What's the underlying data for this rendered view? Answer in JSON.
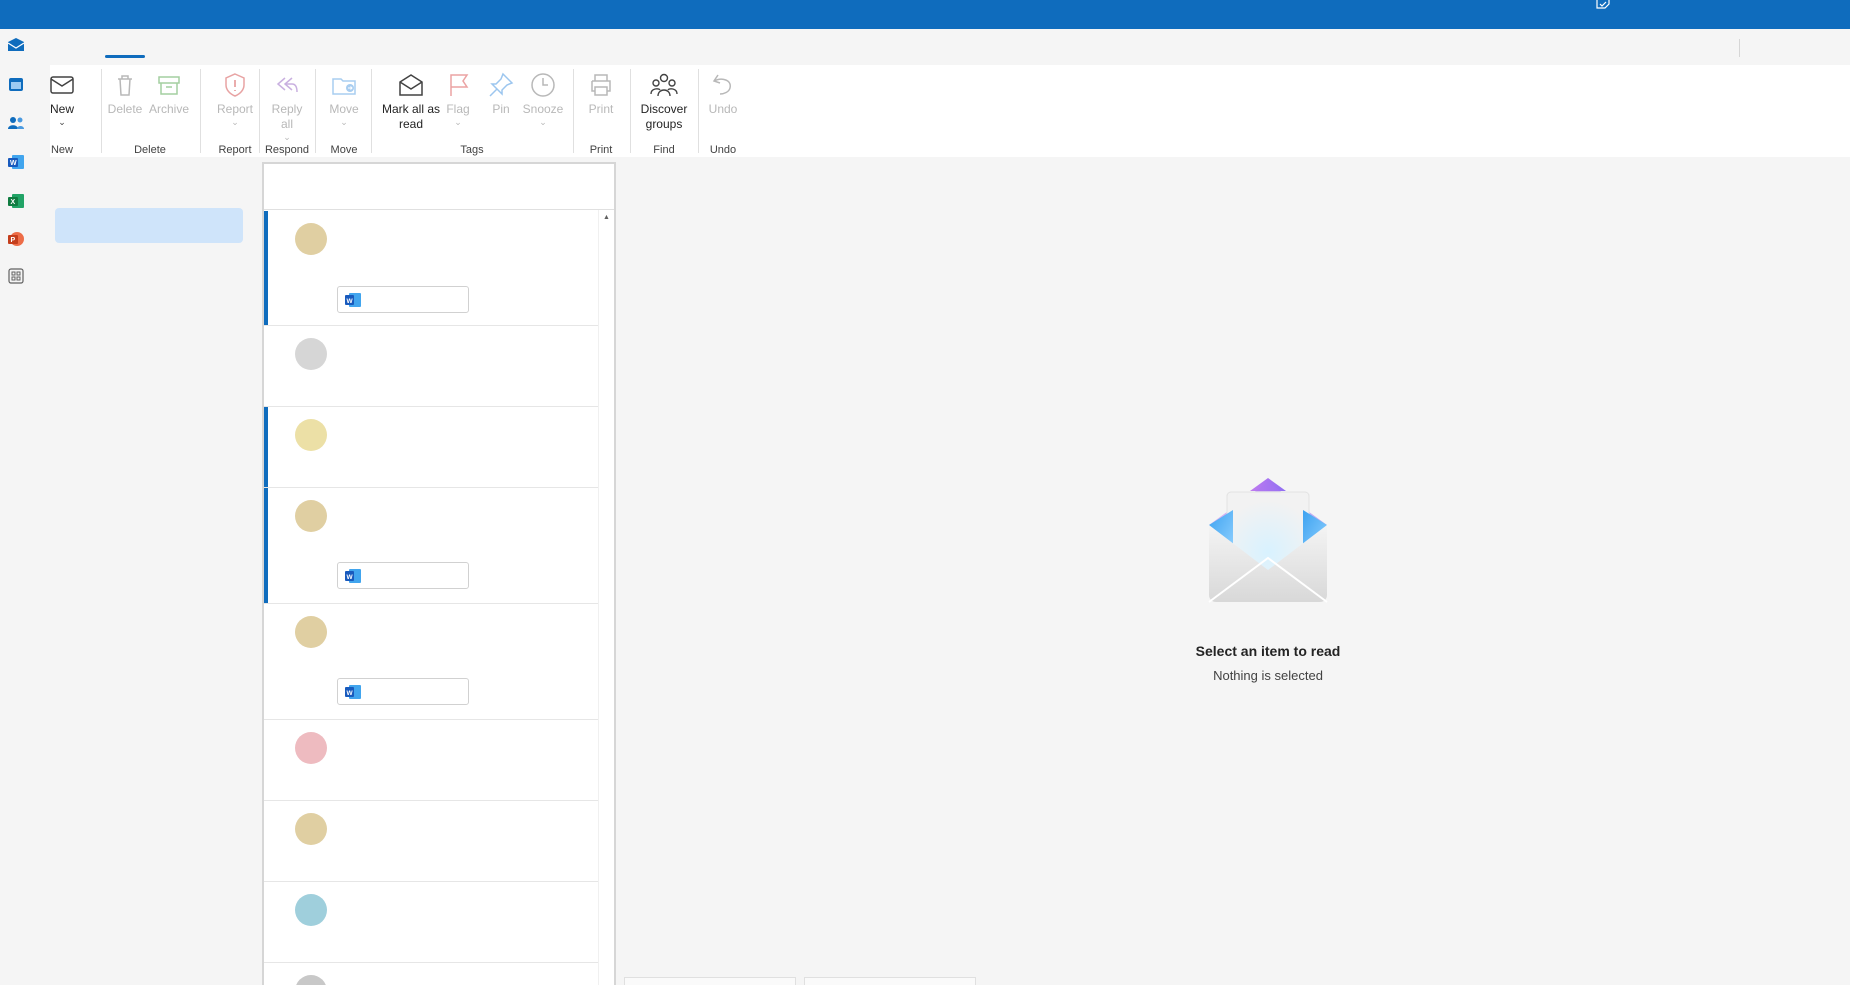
{
  "app": {
    "brand_color": "#0f6cbd",
    "titlebar_icon": "sticky-note-check-icon"
  },
  "left_rail": {
    "items": [
      {
        "name": "mail-app-icon",
        "color": "#0f6cbd"
      },
      {
        "name": "calendar-app-icon",
        "color": "#0f6cbd"
      },
      {
        "name": "people-app-icon",
        "color": "#0f6cbd"
      },
      {
        "name": "word-app-icon",
        "color": "#185abd"
      },
      {
        "name": "excel-app-icon",
        "color": "#107c41"
      },
      {
        "name": "powerpoint-app-icon",
        "color": "#c43e1c"
      },
      {
        "name": "more-apps-icon",
        "color": "#616161"
      }
    ]
  },
  "ribbon": {
    "new": {
      "label": "New",
      "group": "New"
    },
    "delete": {
      "label": "Delete",
      "group": "Delete"
    },
    "archive": {
      "label": "Archive"
    },
    "report": {
      "label": "Report",
      "group": "Report"
    },
    "reply_all": {
      "label_line1": "Reply",
      "label_line2": "all",
      "group": "Respond"
    },
    "move": {
      "label": "Move",
      "group": "Move"
    },
    "mark_all_read": {
      "label_line1": "Mark all as",
      "label_line2": "read"
    },
    "flag": {
      "label": "Flag"
    },
    "pin": {
      "label": "Pin"
    },
    "snooze": {
      "label": "Snooze"
    },
    "tags_group": "Tags",
    "print": {
      "label": "Print",
      "group": "Print"
    },
    "discover_groups": {
      "label_line1": "Discover",
      "label_line2": "groups",
      "group": "Find"
    },
    "undo": {
      "label": "Undo",
      "group": "Undo"
    }
  },
  "message_list": {
    "items": [
      {
        "avatar_color": "#e0cfa2",
        "unread": true,
        "has_attachment": true,
        "attachment_icon": "word-doc-icon"
      },
      {
        "avatar_color": "#d6d6d6",
        "unread": false,
        "has_attachment": false
      },
      {
        "avatar_color": "#ece0a6",
        "unread": true,
        "has_attachment": false
      },
      {
        "avatar_color": "#e0cfa2",
        "unread": true,
        "has_attachment": true,
        "attachment_icon": "word-doc-icon"
      },
      {
        "avatar_color": "#e0cfa2",
        "unread": false,
        "has_attachment": true,
        "attachment_icon": "word-doc-icon"
      },
      {
        "avatar_color": "#eebbc0",
        "unread": false,
        "has_attachment": false
      },
      {
        "avatar_color": "#e0cfa2",
        "unread": false,
        "has_attachment": false
      },
      {
        "avatar_color": "#9fcfdc",
        "unread": false,
        "has_attachment": false
      },
      {
        "avatar_color": "#c8c8c8",
        "unread": false,
        "has_attachment": false
      }
    ]
  },
  "reading_pane": {
    "empty_title": "Select an item to read",
    "empty_subtitle": "Nothing is selected",
    "illustration_icon": "open-envelope-illustration"
  }
}
